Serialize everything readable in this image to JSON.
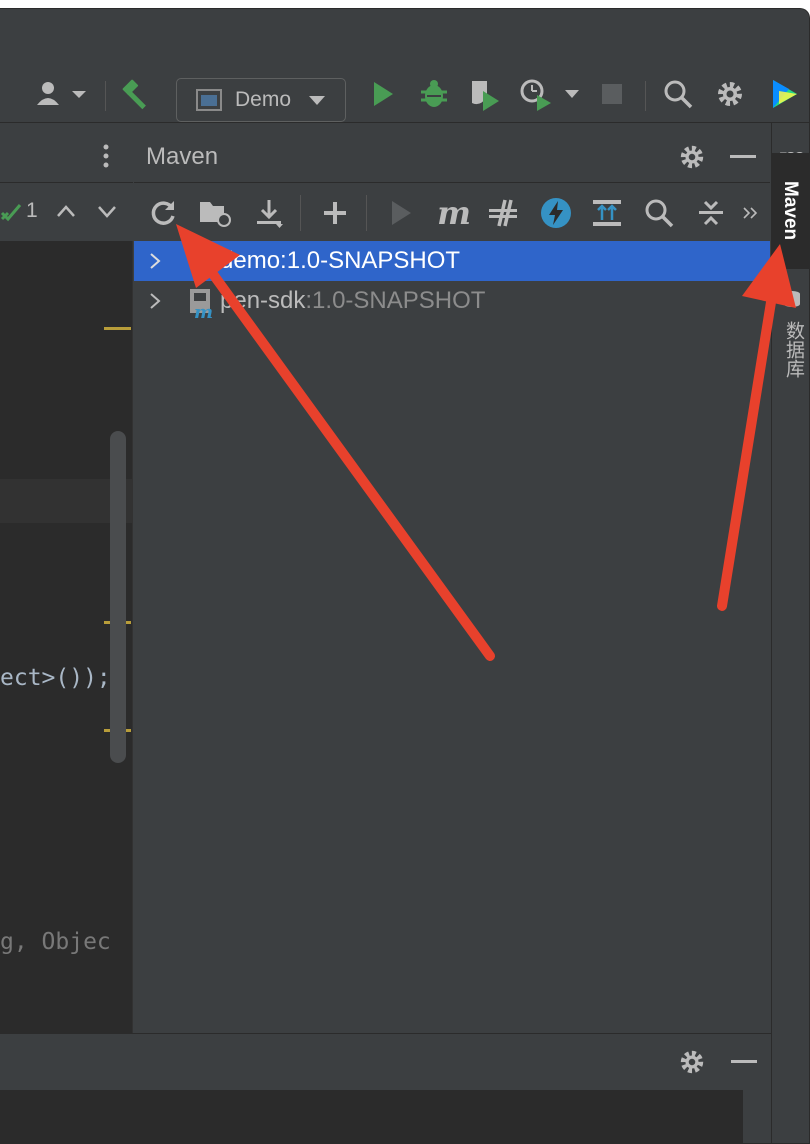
{
  "toolbar": {
    "run_config_label": "Demo"
  },
  "editor": {
    "match_count": "1",
    "code_line_1": "ect>());",
    "code_line_2": "g, Objec"
  },
  "maven": {
    "title": "Maven",
    "tree": [
      {
        "name": "demo",
        "version": ":1.0-SNAPSHOT",
        "selected": true
      },
      {
        "name": "pen-sdk",
        "version": ":1.0-SNAPSHOT",
        "selected": false
      }
    ]
  },
  "stripe": {
    "maven_label": "Maven",
    "database_label": "数据库"
  },
  "colors": {
    "accent_selection": "#2f65ca",
    "annotation_arrow": "#e8412c",
    "run_green": "#499c54"
  },
  "icons": [
    "user-icon",
    "hammer-icon",
    "run-icon",
    "debug-icon",
    "coverage-icon",
    "profile-icon",
    "stop-icon",
    "search-icon",
    "gear-icon",
    "jetbrains-logo-icon",
    "reload-icon",
    "folder-sync-icon",
    "download-icon",
    "add-icon",
    "maven-m-icon",
    "toggle-offline-icon",
    "lightning-icon",
    "collapse-icon",
    "chevron-double-right-icon"
  ]
}
